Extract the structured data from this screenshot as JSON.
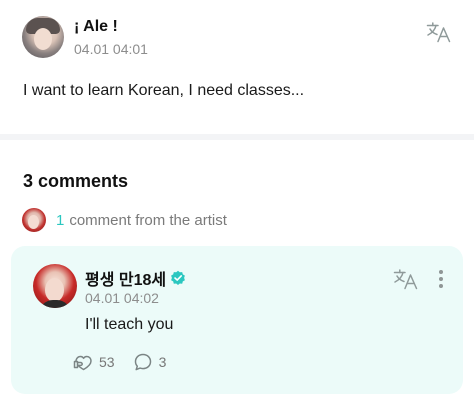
{
  "post": {
    "author": "¡ Ale !",
    "timestamp": "04.01 04:01",
    "body": "I want to learn Korean, I need classes...",
    "translate_icon": "translate-icon"
  },
  "comments_section": {
    "title": "3 comments",
    "artist_count": "1",
    "artist_label": "comment from the artist"
  },
  "artist_comment": {
    "author": "평생 만18세",
    "verified_icon": "verified-badge-icon",
    "timestamp": "04.01 04:02",
    "text": "I'll teach you",
    "likes": "53",
    "replies": "3",
    "like_icon": "like-icon",
    "reply_icon": "reply-bubble-icon",
    "more_icon": "more-vertical-icon"
  },
  "colors": {
    "accent": "#2bc7c0",
    "card_background": "#ecfbf9",
    "muted_text": "#8d8d8d"
  }
}
